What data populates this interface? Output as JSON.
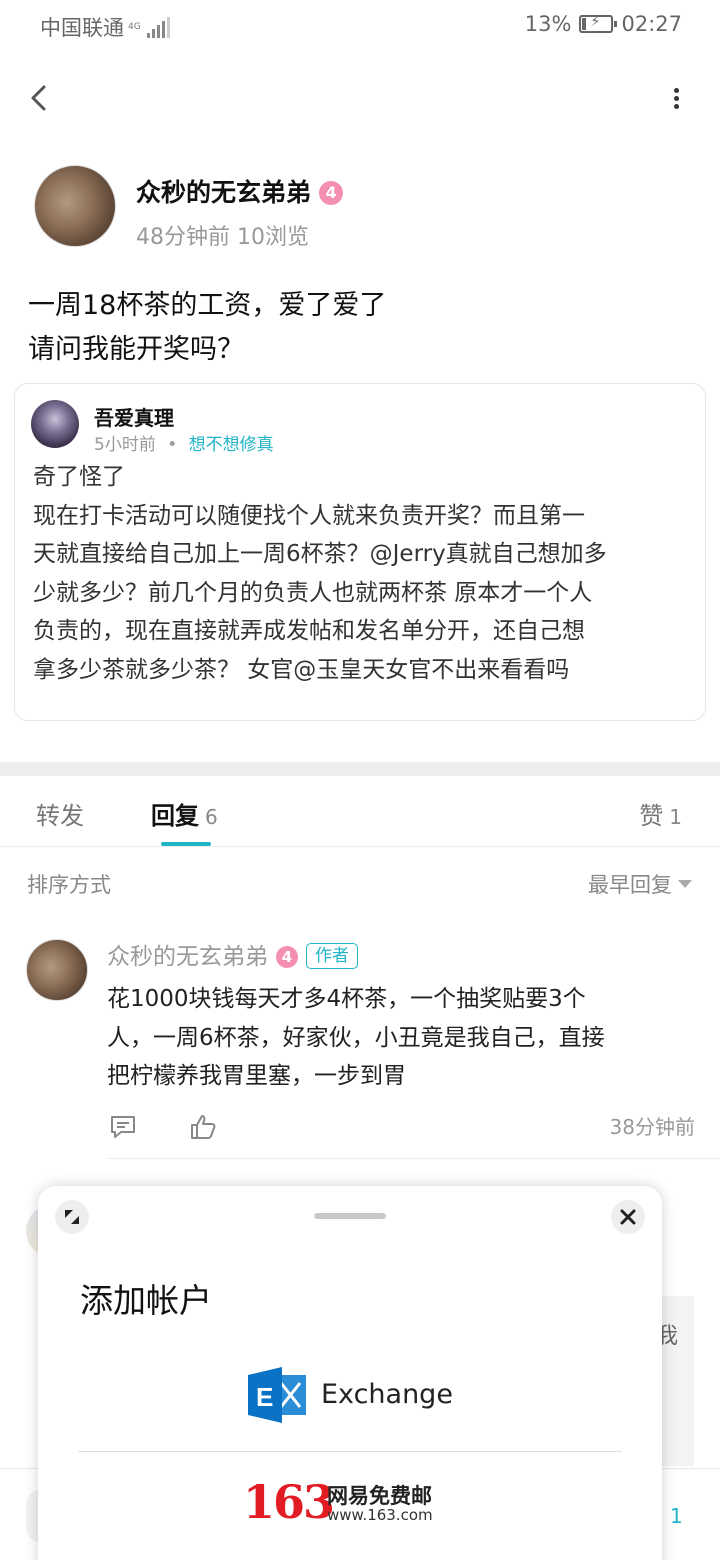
{
  "status_bar": {
    "carrier": "中国联通",
    "network_type": "4G",
    "battery_percent": "13%",
    "battery_level": 0.13,
    "time": "02:27"
  },
  "nav": {
    "back_icon": "chevron-left-icon",
    "more_icon": "more-vertical-icon"
  },
  "post": {
    "author_name": "众秒的无玄弟弟",
    "level": "4",
    "time_ago": "48分钟前",
    "views": "10浏览",
    "content_lines": [
      "一周18杯茶的工资，爱了爱了",
      "请问我能开奖吗？"
    ]
  },
  "quoted": {
    "author_name": "吾爱真理",
    "time_ago": "5小时前",
    "separator": "•",
    "tag": "想不想修真",
    "text_lines": [
      "奇了怪了",
      "现在打卡活动可以随便找个人就来负责开奖？而且第一",
      "天就直接给自己加上一周6杯茶？@Jerry真就自己想加多",
      "少就多少？前几个月的负责人也就两杯茶 原本才一个人",
      "负责的，现在直接就弄成发帖和发名单分开，还自己想",
      "拿多少茶就多少茶？ 女官@玉皇天女官不出来看看吗"
    ]
  },
  "tabs": {
    "forward_label": "转发",
    "reply_label": "回复",
    "reply_count": "6",
    "like_label": "赞",
    "like_count": "1"
  },
  "sort": {
    "label": "排序方式",
    "selected": "最早回复"
  },
  "reply": {
    "author_name": "众秒的无玄弟弟",
    "level": "4",
    "author_tag": "作者",
    "text_lines": [
      "花1000块钱每天才多4杯茶，一个抽奖贴要3个",
      "人，一周6杯茶，好家伙，小丑竟是我自己，直接",
      "把柠檬养我胃里塞，一步到胃"
    ],
    "time_ago": "38分钟前",
    "comment_icon": "comment-icon",
    "like_icon": "thumbs-up-icon"
  },
  "background_peek": {
    "partial_char": "我",
    "count": "1"
  },
  "sheet": {
    "title": "添加帐户",
    "exchange_label": "Exchange",
    "mail163_logo": "163",
    "mail163_name": "网易免费邮",
    "mail163_url": "www.163.com"
  },
  "colors": {
    "accent": "#22b5c8",
    "level_badge": "#f58fb1",
    "exchange_blue": "#0a72c4",
    "mail163_red": "#e21c23"
  }
}
